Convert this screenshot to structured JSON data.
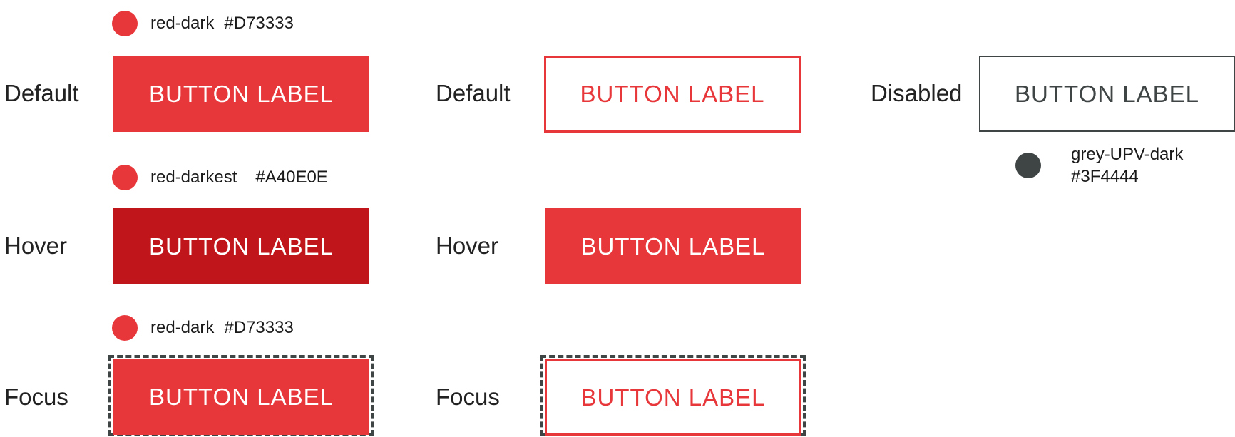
{
  "colors": {
    "red_dark": "#D73333",
    "red_fill": "#E8373A",
    "red_darkest": "#A40E0E",
    "red_darkest_fill": "#C0151A",
    "grey_upv_dark": "#3F4444"
  },
  "swatches": {
    "default_fill": {
      "name": "red-dark",
      "hex": "#D73333"
    },
    "hover_fill": {
      "name": "red-darkest",
      "hex": "#A40E0E"
    },
    "focus_fill": {
      "name": "red-dark",
      "hex": "#D73333"
    },
    "disabled": {
      "name": "grey-UPV-dark",
      "hex": "#3F4444"
    }
  },
  "states": {
    "default": "Default",
    "hover": "Hover",
    "focus": "Focus",
    "disabled": "Disabled"
  },
  "button_label": "BUTTON LABEL"
}
